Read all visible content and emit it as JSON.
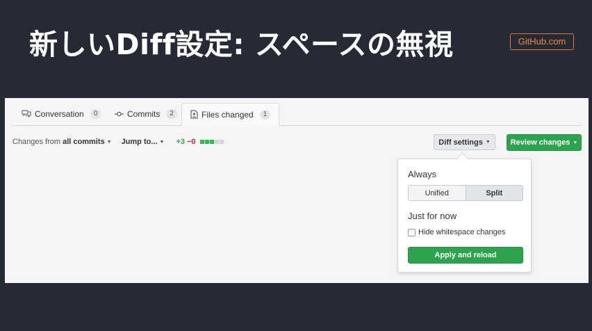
{
  "slide": {
    "title": "新しいDiff設定: スペースの無視",
    "brand": "GitHub.com"
  },
  "tabs": [
    {
      "label": "Conversation",
      "count": "0",
      "icon": "comment-discussion-icon"
    },
    {
      "label": "Commits",
      "count": "2",
      "icon": "git-commit-icon"
    },
    {
      "label": "Files changed",
      "count": "1",
      "icon": "file-diff-icon"
    }
  ],
  "toolbar": {
    "changes_prefix": "Changes from",
    "changes_value": "all commits",
    "jump_label": "Jump to...",
    "additions": "+3",
    "deletions": "−0",
    "diffstat_colors": [
      "#2cbe4e",
      "#2cbe4e",
      "#2cbe4e",
      "#d1d5da",
      "#d1d5da"
    ],
    "diff_settings_label": "Diff settings",
    "review_changes_label": "Review changes"
  },
  "popover": {
    "always_heading": "Always",
    "unified_label": "Unified",
    "split_label": "Split",
    "selected_view": "Split",
    "just_for_now_heading": "Just for now",
    "hide_whitespace_label": "Hide whitespace changes",
    "hide_whitespace_checked": false,
    "apply_label": "Apply and reload"
  },
  "colors": {
    "background": "#262a35",
    "accent_green": "#2ca44e",
    "brand_orange": "#f0883e"
  }
}
